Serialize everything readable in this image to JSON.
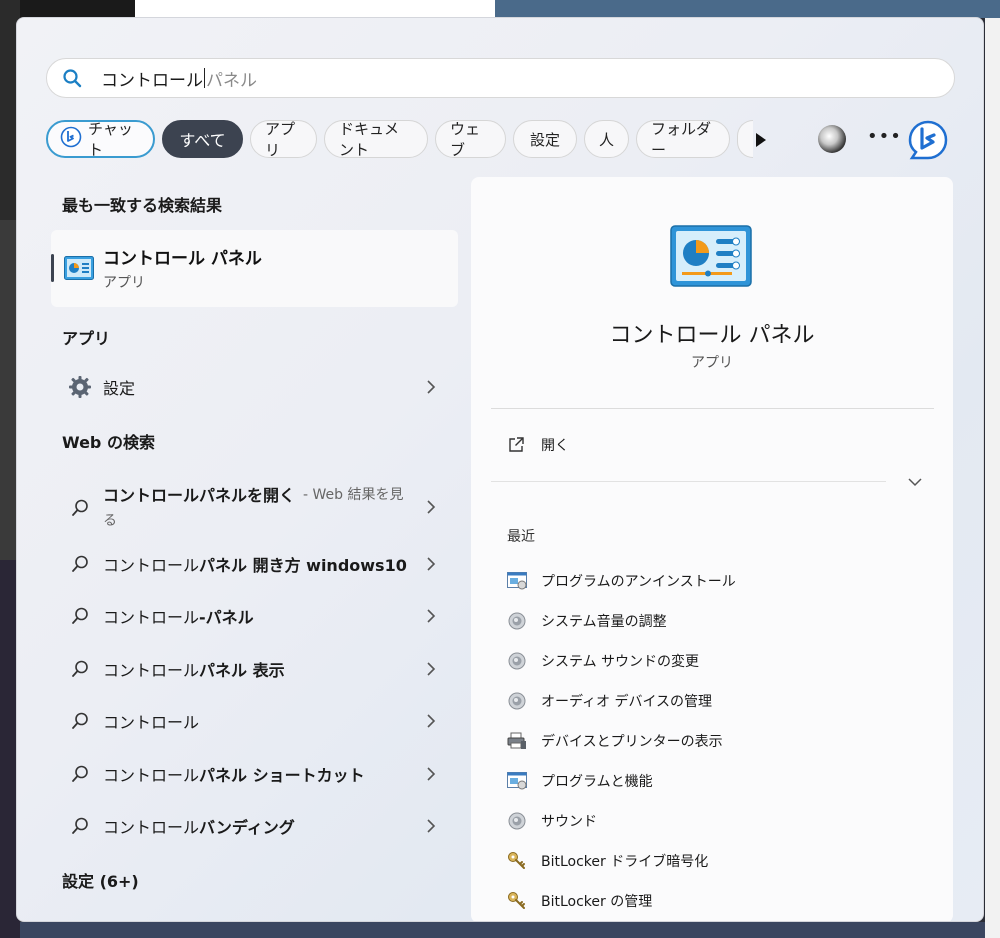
{
  "search": {
    "typed": "コントロール",
    "ghost": "パネル"
  },
  "filters": {
    "chat": "チャット",
    "all": "すべて",
    "apps": "アプリ",
    "documents": "ドキュメント",
    "web": "ウェブ",
    "settings": "設定",
    "people": "人",
    "folders": "フォルダー"
  },
  "left": {
    "best_match_header": "最も一致する検索結果",
    "best_match": {
      "title": "コントロール パネル",
      "subtitle": "アプリ"
    },
    "apps_header": "アプリ",
    "apps": [
      {
        "label": "設定"
      }
    ],
    "web_header": "Web の検索",
    "web_results": [
      {
        "bold": "コントロールパネルを開く",
        "sub": " - Web 結果を見",
        "wrap": "る"
      },
      {
        "prefix": "コントロール",
        "bold": "パネル 開き方 windows10"
      },
      {
        "prefix": "コントロール",
        "bold": "-パネル"
      },
      {
        "prefix": "コントロール",
        "bold": "パネル 表示"
      },
      {
        "prefix": "コントロール",
        "bold": ""
      },
      {
        "prefix": "コントロール",
        "bold": "パネル ショートカット"
      },
      {
        "prefix": "コントロール",
        "bold": "バンディング"
      }
    ],
    "settings_header": "設定 (6+)"
  },
  "right": {
    "title": "コントロール パネル",
    "subtitle": "アプリ",
    "open_label": "開く",
    "recent_header": "最近",
    "recent": [
      {
        "label": "プログラムのアンインストール",
        "icon": "programs-icon"
      },
      {
        "label": "システム音量の調整",
        "icon": "speaker-icon"
      },
      {
        "label": "システム サウンドの変更",
        "icon": "speaker-icon"
      },
      {
        "label": "オーディオ デバイスの管理",
        "icon": "speaker-icon"
      },
      {
        "label": "デバイスとプリンターの表示",
        "icon": "printer-icon"
      },
      {
        "label": "プログラムと機能",
        "icon": "programs-icon"
      },
      {
        "label": "サウンド",
        "icon": "speaker-icon"
      },
      {
        "label": "BitLocker ドライブ暗号化",
        "icon": "key-icon"
      },
      {
        "label": "BitLocker の管理",
        "icon": "key-icon"
      }
    ]
  },
  "colors": {
    "accent_chip": "#3c4350",
    "chat_border": "#3a9bd0",
    "bing_blue": "#1f6fd1"
  }
}
